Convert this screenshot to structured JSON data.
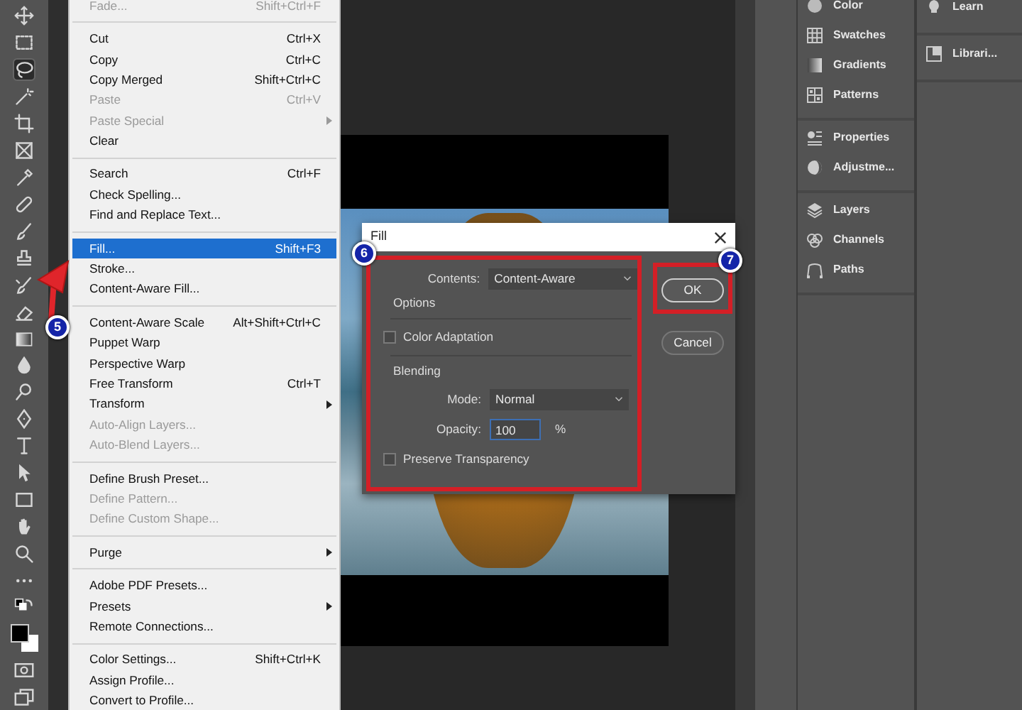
{
  "toolbar": {
    "tools": [
      {
        "selected": false
      },
      {
        "selected": false
      },
      {
        "selected": true
      },
      {
        "selected": false
      },
      {
        "selected": false
      },
      {
        "selected": false
      },
      {
        "selected": false
      },
      {
        "selected": false
      },
      {
        "selected": false
      },
      {
        "selected": false
      },
      {
        "selected": false
      },
      {
        "selected": false
      },
      {
        "selected": false
      },
      {
        "selected": false
      },
      {
        "selected": false
      },
      {
        "selected": false
      },
      {
        "selected": false
      },
      {
        "selected": false
      },
      {
        "selected": false
      },
      {
        "selected": false
      },
      {
        "selected": false
      },
      {
        "selected": false
      }
    ]
  },
  "edit_menu": {
    "callout": "5",
    "groups": [
      [
        {
          "label": "Fade...",
          "shortcut": "Shift+Ctrl+F",
          "disabled": true,
          "submenu": false,
          "selected": false
        }
      ],
      [
        {
          "label": "Cut",
          "shortcut": "Ctrl+X",
          "disabled": false,
          "submenu": false,
          "selected": false
        },
        {
          "label": "Copy",
          "shortcut": "Ctrl+C",
          "disabled": false,
          "submenu": false,
          "selected": false
        },
        {
          "label": "Copy Merged",
          "shortcut": "Shift+Ctrl+C",
          "disabled": false,
          "submenu": false,
          "selected": false
        },
        {
          "label": "Paste",
          "shortcut": "Ctrl+V",
          "disabled": true,
          "submenu": false,
          "selected": false
        },
        {
          "label": "Paste Special",
          "disabled": true,
          "submenu": true,
          "selected": false
        },
        {
          "label": "Clear",
          "disabled": false,
          "submenu": false,
          "selected": false
        }
      ],
      [
        {
          "label": "Search",
          "shortcut": "Ctrl+F",
          "disabled": false,
          "submenu": false,
          "selected": false
        },
        {
          "label": "Check Spelling...",
          "disabled": false,
          "submenu": false,
          "selected": false
        },
        {
          "label": "Find and Replace Text...",
          "disabled": false,
          "submenu": false,
          "selected": false
        }
      ],
      [
        {
          "label": "Fill...",
          "shortcut": "Shift+F3",
          "disabled": false,
          "submenu": false,
          "selected": true
        },
        {
          "label": "Stroke...",
          "disabled": false,
          "submenu": false,
          "selected": false
        },
        {
          "label": "Content-Aware Fill...",
          "disabled": false,
          "submenu": false,
          "selected": false
        }
      ],
      [
        {
          "label": "Content-Aware Scale",
          "shortcut": "Alt+Shift+Ctrl+C",
          "disabled": false,
          "submenu": false,
          "selected": false
        },
        {
          "label": "Puppet Warp",
          "disabled": false,
          "submenu": false,
          "selected": false
        },
        {
          "label": "Perspective Warp",
          "disabled": false,
          "submenu": false,
          "selected": false
        },
        {
          "label": "Free Transform",
          "shortcut": "Ctrl+T",
          "disabled": false,
          "submenu": false,
          "selected": false
        },
        {
          "label": "Transform",
          "disabled": false,
          "submenu": true,
          "selected": false
        },
        {
          "label": "Auto-Align Layers...",
          "disabled": true,
          "submenu": false,
          "selected": false
        },
        {
          "label": "Auto-Blend Layers...",
          "disabled": true,
          "submenu": false,
          "selected": false
        }
      ],
      [
        {
          "label": "Define Brush Preset...",
          "disabled": false,
          "submenu": false,
          "selected": false
        },
        {
          "label": "Define Pattern...",
          "disabled": true,
          "submenu": false,
          "selected": false
        },
        {
          "label": "Define Custom Shape...",
          "disabled": true,
          "submenu": false,
          "selected": false
        }
      ],
      [
        {
          "label": "Purge",
          "disabled": false,
          "submenu": true,
          "selected": false
        }
      ],
      [
        {
          "label": "Adobe PDF Presets...",
          "disabled": false,
          "submenu": false,
          "selected": false
        },
        {
          "label": "Presets",
          "disabled": false,
          "submenu": true,
          "selected": false
        },
        {
          "label": "Remote Connections...",
          "disabled": false,
          "submenu": false,
          "selected": false
        }
      ],
      [
        {
          "label": "Color Settings...",
          "shortcut": "Shift+Ctrl+K",
          "disabled": false,
          "submenu": false,
          "selected": false
        },
        {
          "label": "Assign Profile...",
          "disabled": false,
          "submenu": false,
          "selected": false
        },
        {
          "label": "Convert to Profile...",
          "disabled": false,
          "submenu": false,
          "selected": false
        }
      ]
    ]
  },
  "panels": {
    "groups": [
      [
        {
          "label": "Color"
        },
        {
          "label": "Swatches"
        },
        {
          "label": "Gradients"
        },
        {
          "label": "Patterns"
        }
      ],
      [
        {
          "label": "Properties"
        },
        {
          "label": "Adjustme..."
        }
      ],
      [
        {
          "label": "Layers"
        },
        {
          "label": "Channels"
        },
        {
          "label": "Paths"
        }
      ]
    ],
    "side_items": [
      {
        "label": "Learn"
      },
      {
        "label": "Librari..."
      }
    ]
  },
  "fill_dialog": {
    "title": "Fill",
    "callout": "6",
    "ok_callout": "7",
    "contents_label": "Contents:",
    "contents_value": "Content-Aware",
    "options_heading": "Options",
    "color_adaptation": {
      "label": "Color Adaptation",
      "checked": false
    },
    "blending_heading": "Blending",
    "mode_label": "Mode:",
    "mode_value": "Normal",
    "opacity_label": "Opacity:",
    "opacity_value": "100",
    "opacity_unit": "%",
    "preserve_transparency": {
      "label": "Preserve Transparency",
      "checked": false
    },
    "buttons": [
      {
        "label": "OK",
        "highlighted": true
      },
      {
        "label": "Cancel",
        "highlighted": false
      }
    ]
  }
}
